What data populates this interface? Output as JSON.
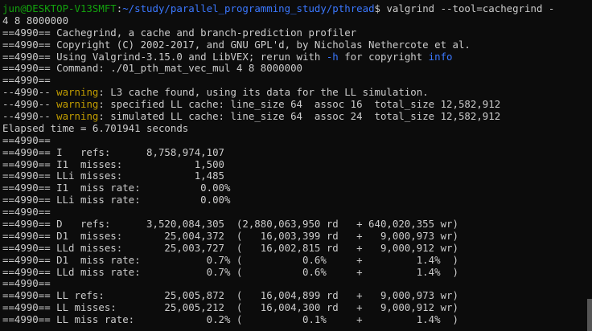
{
  "terminal": {
    "colors": {
      "prompt_user": "#13a10e",
      "prompt_path": "#3b78ff",
      "warning": "#c19c00",
      "option": "#3b78ff",
      "text": "#cccccc",
      "background": "#0c0c0c"
    },
    "prompt": {
      "user_host": "jun@DESKTOP-V13SMFT",
      "separator": ":",
      "path": "~/study/parallel_programming_study/pthread",
      "symbol": "$",
      "command": " valgrind --tool=cachegrind -"
    },
    "lines": [
      "4 8 8000000",
      "==4990== Cachegrind, a cache and branch-prediction profiler",
      "==4990== Copyright (C) 2002-2017, and GNU GPL'd, by Nicholas Nethercote et al.",
      "==4990== Command: ./01_pth_mat_vec_mul 4 8 8000000",
      "==4990==",
      "Elapsed time = 6.701941 seconds",
      "==4990==",
      "==4990== I   refs:      8,758,974,107",
      "==4990== I1  misses:            1,500",
      "==4990== LLi misses:            1,485",
      "==4990== I1  miss rate:          0.00%",
      "==4990== LLi miss rate:          0.00%",
      "==4990==",
      "==4990== D   refs:      3,520,084,305  (2,880,063,950 rd   + 640,020,355 wr)",
      "==4990== D1  misses:       25,004,372  (   16,003,399 rd   +   9,000,973 wr)",
      "==4990== LLd misses:       25,003,727  (   16,002,815 rd   +   9,000,912 wr)",
      "==4990== D1  miss rate:           0.7% (          0.6%     +         1.4%  )",
      "==4990== LLd miss rate:           0.7% (          0.6%     +         1.4%  )",
      "==4990==",
      "==4990== LL refs:          25,005,872  (   16,004,899 rd   +   9,000,973 wr)",
      "==4990== LL misses:        25,005,212  (   16,004,300 rd   +   9,000,912 wr)",
      "==4990== LL miss rate:            0.2% (          0.1%     +         1.4%  )"
    ],
    "version_line": {
      "pre": "==4990== Using Valgrind-3.15.0 and LibVEX; rerun with ",
      "opt": "-h",
      "mid": " for copyright ",
      "info": "info"
    },
    "warnings": {
      "prefix": "--4990-- ",
      "word": "warning",
      "w1": ": L3 cache found, using its data for the LL simulation.",
      "w2": ": specified LL cache: line_size 64  assoc 16  total_size 12,582,912",
      "w3": ": simulated LL cache: line_size 64  assoc 24  total_size 12,582,912"
    }
  }
}
